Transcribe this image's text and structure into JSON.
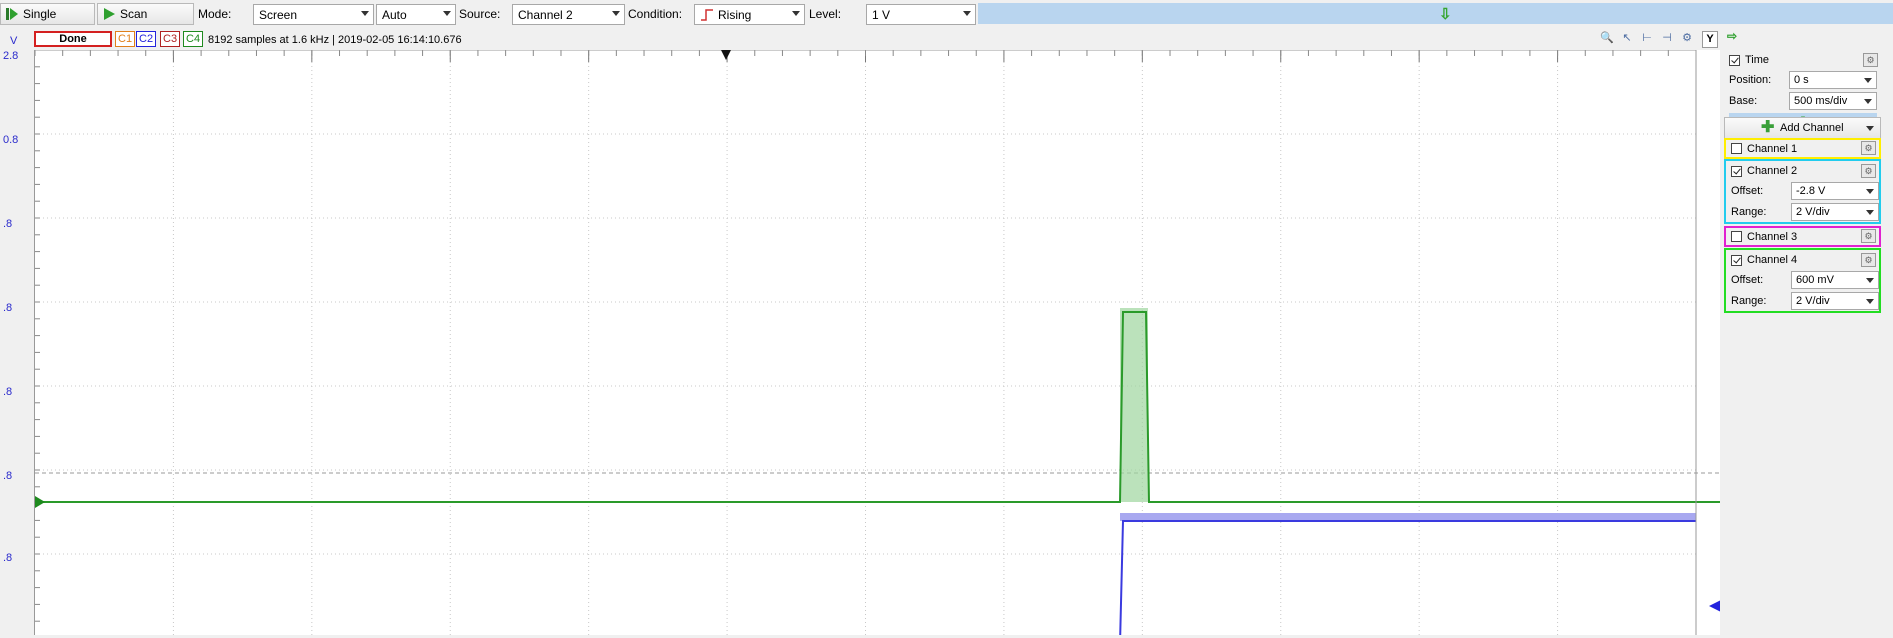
{
  "toolbar": {
    "single_label": "Single",
    "scan_label": "Scan",
    "mode_label": "Mode:",
    "mode_value": "Screen",
    "auto_value": "Auto",
    "source_label": "Source:",
    "source_value": "Channel 2",
    "condition_label": "Condition:",
    "condition_value": "Rising",
    "level_label": "Level:",
    "level_value": "1 V"
  },
  "status": {
    "v_unit": "V",
    "state": "Done",
    "channels": [
      "C1",
      "C2",
      "C3",
      "C4"
    ],
    "samples_text": "8192 samples at 1.6 kHz | 2019-02-05 16:14:10.676",
    "y_button": "Y"
  },
  "y_axis": {
    "tick_labels": [
      "2.8",
      "0.8",
      ".8",
      ".8",
      ".8",
      ".8",
      ".8"
    ]
  },
  "time_panel": {
    "title": "Time",
    "position_label": "Position:",
    "position_value": "0 s",
    "base_label": "Base:",
    "base_value": "500 ms/div"
  },
  "add_channel_label": "Add Channel",
  "channels": [
    {
      "name": "Channel 1",
      "enabled": false,
      "color": "#ffee00"
    },
    {
      "name": "Channel 2",
      "enabled": true,
      "color": "#22ccee",
      "offset_label": "Offset:",
      "offset": "-2.8 V",
      "range_label": "Range:",
      "range": "2 V/div"
    },
    {
      "name": "Channel 3",
      "enabled": false,
      "color": "#e020d0"
    },
    {
      "name": "Channel 4",
      "enabled": true,
      "color": "#22dd22",
      "offset_label": "Offset:",
      "offset": "600 mV",
      "range_label": "Range:",
      "range": "2 V/div"
    }
  ],
  "colors": {
    "c1": "#e0801a",
    "c2": "#2222dd",
    "c3": "#b02020",
    "c4": "#1e8a1e",
    "trace_c2": "#3a3adf",
    "trace_c4": "#2a9a2a"
  }
}
